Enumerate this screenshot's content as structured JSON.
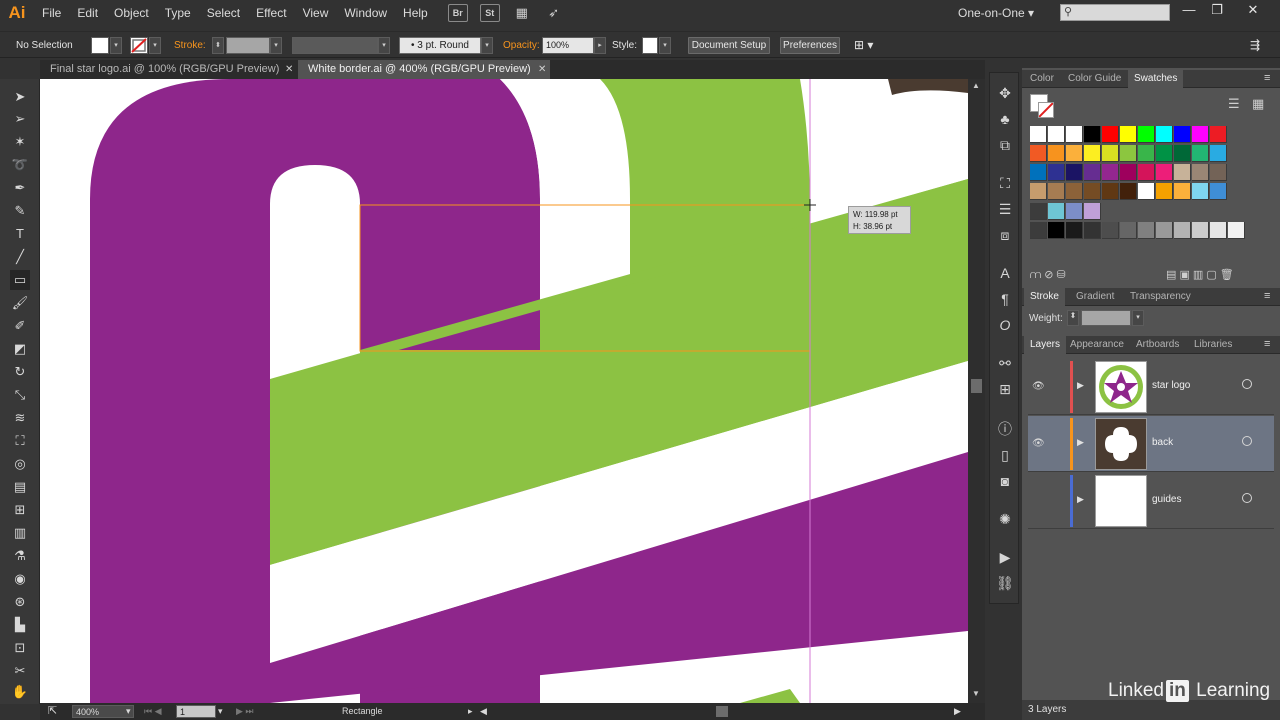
{
  "app": {
    "logo": "Ai",
    "menu": [
      "File",
      "Edit",
      "Object",
      "Type",
      "Select",
      "Effect",
      "View",
      "Window",
      "Help"
    ],
    "bridge_label": "Br",
    "stock_label": "St",
    "workspace": "One-on-One",
    "workspace_arrow": "▾",
    "window_controls": [
      "—",
      "❐",
      "✕"
    ]
  },
  "control_bar": {
    "selection_status": "No Selection",
    "stroke_label": "Stroke:",
    "brush_label": "3 pt. Round",
    "opacity_label": "Opacity:",
    "opacity_value": "100%",
    "style_label": "Style:",
    "document_setup": "Document Setup",
    "preferences": "Preferences"
  },
  "tabs": [
    {
      "label": "Final star logo.ai @ 100% (RGB/GPU Preview)",
      "close": "✕"
    },
    {
      "label": "White border.ai @ 400% (RGB/GPU Preview)",
      "close": "✕"
    }
  ],
  "canvas": {
    "tooltip_w": "W: 119.98 pt",
    "tooltip_h": "H: 38.96 pt",
    "colors": {
      "purple": "#8e268b",
      "green": "#8cc243",
      "guide": "#d67ad6",
      "selection": "#f7941d"
    }
  },
  "status_bar": {
    "zoom": "400%",
    "artboard": "1",
    "tool_name": "Rectangle"
  },
  "panels": {
    "color_tabs": [
      "Color",
      "Color Guide",
      "Swatches"
    ],
    "stroke_tabs": [
      "Stroke",
      "Gradient",
      "Transparency"
    ],
    "weight_label": "Weight:",
    "layer_tabs": [
      "Layers",
      "Appearance",
      "Artboards",
      "Libraries"
    ],
    "layers": [
      {
        "name": "star logo",
        "color": "#e05050"
      },
      {
        "name": "back",
        "color": "#f7941d"
      },
      {
        "name": "guides",
        "color": "#4a6cd4"
      }
    ],
    "layers_count": "3 Layers",
    "swatch_rows": [
      [
        "#ffffff",
        "#ffffff",
        "#ffffff",
        "#000000",
        "#ff0000",
        "#ffff00",
        "#00ff00",
        "#00ffff",
        "#0000ff",
        "#ff00ff",
        "#ed1c24"
      ],
      [
        "#f15a24",
        "#f7931e",
        "#fbb03b",
        "#fcee21",
        "#d9e021",
        "#8cc63f",
        "#39b54a",
        "#009245",
        "#006837",
        "#22b573",
        "#29abe2"
      ],
      [
        "#0071bc",
        "#2e3192",
        "#1b1464",
        "#662d91",
        "#93278f",
        "#9e005d",
        "#d4145a",
        "#ed1e79",
        "#c7b299",
        "#998675",
        "#736357"
      ],
      [
        "#c69c6d",
        "#a67c52",
        "#8c6239",
        "#754c24",
        "#603813",
        "#42210b",
        "#ffffff",
        "#f4a100",
        "#fbb03b",
        "#7fd6f0",
        "#3f8ed6"
      ],
      [
        "#3c3c3c",
        "#6ec5d4",
        "#7c8ec8",
        "#c0a0d8"
      ],
      [
        "#3c3c3c",
        "#000000",
        "#1a1a1a",
        "#333333",
        "#4d4d4d",
        "#666666",
        "#808080",
        "#999999",
        "#b3b3b3",
        "#cccccc",
        "#e6e6e6",
        "#f2f2f2"
      ]
    ]
  },
  "watermark": {
    "part1": "Linked",
    "part2": "in",
    "part3": " Learning"
  }
}
